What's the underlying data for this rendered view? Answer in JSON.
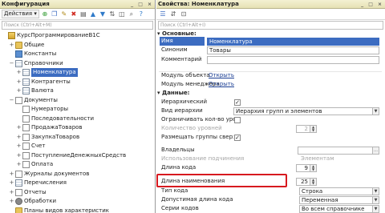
{
  "config_panel": {
    "title": "Конфигурация",
    "window_buttons": "_ □ ×",
    "actions_label": "Действия",
    "search_placeholder": "Поиск (Ctrl+Alt+M)",
    "tree": [
      {
        "label": "КурсПрограммированиеВ1С",
        "icon": "book-icon",
        "indent": 0,
        "toggle": "",
        "selected": false
      },
      {
        "label": "Общие",
        "icon": "folder-icon",
        "indent": 1,
        "toggle": "+",
        "selected": false
      },
      {
        "label": "Константы",
        "icon": "constants-icon",
        "indent": 1,
        "toggle": "",
        "selected": false
      },
      {
        "label": "Справочники",
        "icon": "catalog-icon",
        "indent": 1,
        "toggle": "−",
        "selected": false
      },
      {
        "label": "Номенклатура",
        "icon": "catalog-icon",
        "indent": 2,
        "toggle": "+",
        "selected": true
      },
      {
        "label": "Контрагенты",
        "icon": "catalog-icon",
        "indent": 2,
        "toggle": "+",
        "selected": false
      },
      {
        "label": "Валюта",
        "icon": "catalog-icon",
        "indent": 2,
        "toggle": "+",
        "selected": false
      },
      {
        "label": "Документы",
        "icon": "document-icon",
        "indent": 1,
        "toggle": "−",
        "selected": false
      },
      {
        "label": "Нумераторы",
        "icon": "document-icon",
        "indent": 2,
        "toggle": "",
        "selected": false
      },
      {
        "label": "Последовательности",
        "icon": "document-icon",
        "indent": 2,
        "toggle": "",
        "selected": false
      },
      {
        "label": "ПродажаТоваров",
        "icon": "document-icon",
        "indent": 2,
        "toggle": "+",
        "selected": false
      },
      {
        "label": "ЗакупкаТоваров",
        "icon": "document-icon",
        "indent": 2,
        "toggle": "+",
        "selected": false
      },
      {
        "label": "Счет",
        "icon": "document-icon",
        "indent": 2,
        "toggle": "+",
        "selected": false
      },
      {
        "label": "ПоступлениеДенежныхСредств",
        "icon": "document-icon",
        "indent": 2,
        "toggle": "+",
        "selected": false
      },
      {
        "label": "Оплата",
        "icon": "document-icon",
        "indent": 2,
        "toggle": "+",
        "selected": false
      },
      {
        "label": "Журналы документов",
        "icon": "journal-icon",
        "indent": 1,
        "toggle": "+",
        "selected": false
      },
      {
        "label": "Перечисления",
        "icon": "enum-icon",
        "indent": 1,
        "toggle": "+",
        "selected": false
      },
      {
        "label": "Отчеты",
        "icon": "report-icon",
        "indent": 1,
        "toggle": "+",
        "selected": false
      },
      {
        "label": "Обработки",
        "icon": "gear-icon",
        "indent": 1,
        "toggle": "+",
        "selected": false
      },
      {
        "label": "Планы видов характеристик",
        "icon": "folder-icon",
        "indent": 1,
        "toggle": "",
        "selected": false
      }
    ]
  },
  "props_panel": {
    "title": "Свойства: Номенклатура",
    "search_placeholder": "Поиск (Ctrl+Alt+I)",
    "groups": {
      "basic": "Основные:",
      "data": "Данные:"
    },
    "rows": {
      "name": {
        "label": "Имя",
        "value": "Номенклатура"
      },
      "synonym": {
        "label": "Синоним",
        "value": "Товары"
      },
      "comment": {
        "label": "Комментарий",
        "value": ""
      },
      "object_module": {
        "label": "Модуль объекта",
        "value": "Открыть"
      },
      "manager_module": {
        "label": "Модуль менеджера",
        "value": "Открыть"
      },
      "hierarchical": {
        "label": "Иерархический",
        "checked": true
      },
      "hierarchy_type": {
        "label": "Вид иерархии",
        "value": "Иерархия групп и элементов"
      },
      "limit_levels": {
        "label": "Ограничивать кол-во уровней",
        "checked": false
      },
      "level_count": {
        "label": "Количество уровней",
        "value": "2"
      },
      "groups_on_top": {
        "label": "Размещать группы сверху",
        "checked": true
      },
      "owners": {
        "label": "Владельцы",
        "value": ""
      },
      "subordination": {
        "label": "Использование подчинения",
        "value": "Элементам"
      },
      "code_length": {
        "label": "Длина кода",
        "value": "9"
      },
      "name_length": {
        "label": "Длина наименования",
        "value": "25"
      },
      "code_type": {
        "label": "Тип кода",
        "value": "Строка"
      },
      "allowed_code_length": {
        "label": "Допустимая длина кода",
        "value": "Переменная"
      },
      "code_series": {
        "label": "Серии кодов",
        "value": "Во всем справочнике"
      }
    }
  },
  "colors": {
    "selection": "#3c6cc1",
    "highlight_frame": "#d7191f",
    "title_bar": "#e6e1b4",
    "link": "#1c3f94"
  }
}
